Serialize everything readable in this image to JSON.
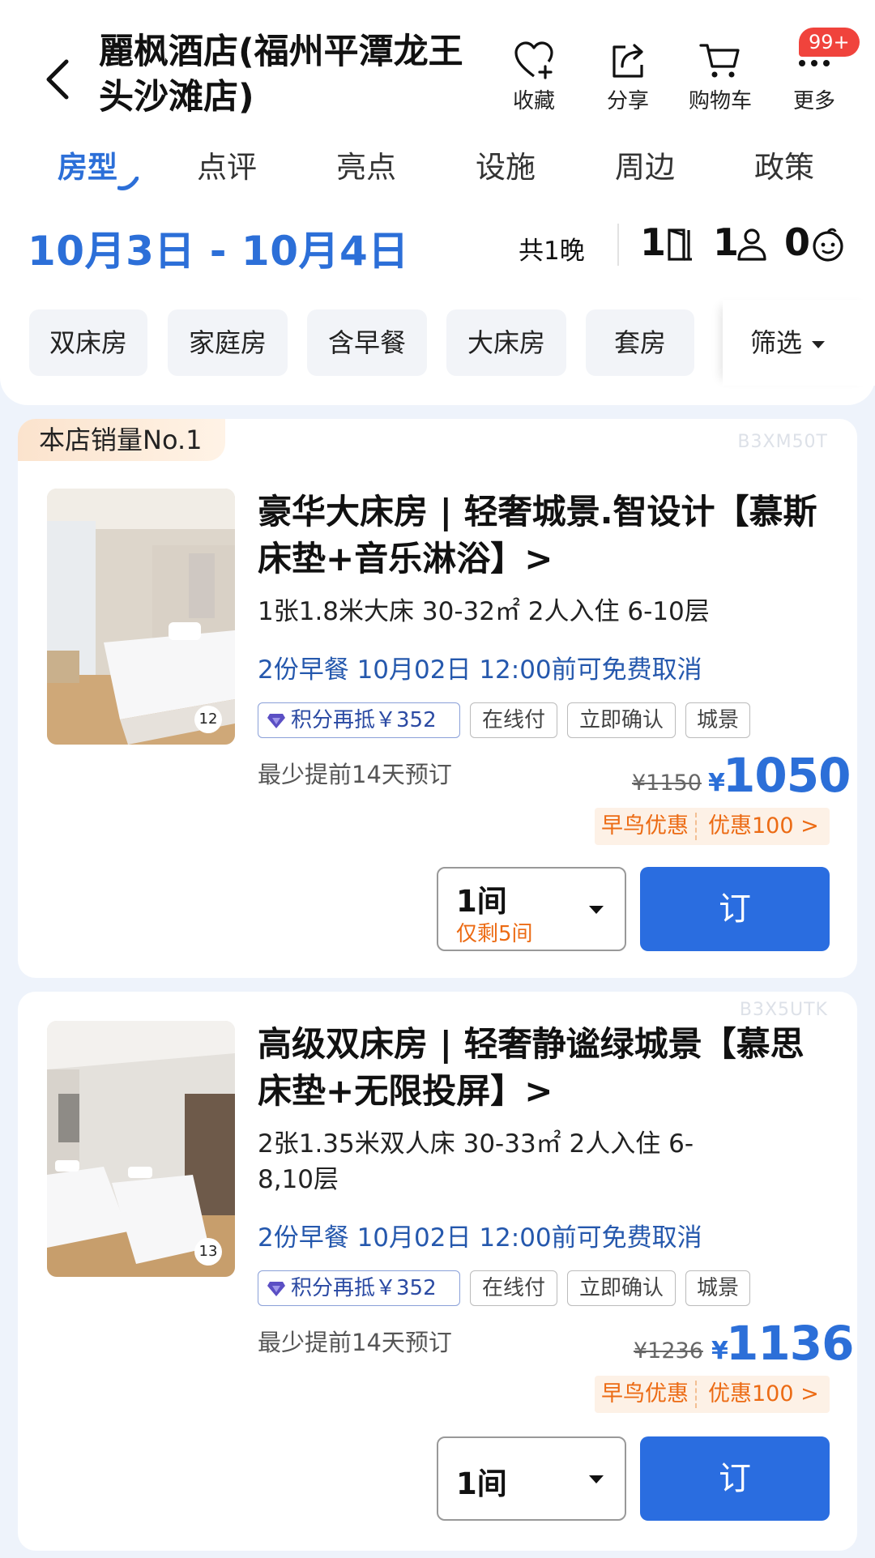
{
  "header": {
    "hotel_name": "麗枫酒店(福州平潭龙王头沙滩店)",
    "actions": [
      {
        "label": "收藏",
        "icon": "heart-plus-icon"
      },
      {
        "label": "分享",
        "icon": "share-icon"
      },
      {
        "label": "购物车",
        "icon": "cart-icon"
      },
      {
        "label": "更多",
        "icon": "more-icon"
      }
    ],
    "badge": "99+"
  },
  "tabs": [
    "房型",
    "点评",
    "亮点",
    "设施",
    "周边",
    "政策"
  ],
  "active_tab": "房型",
  "stay": {
    "dates": "10月3日 - 10月4日",
    "nights": "共1晚",
    "rooms": "1",
    "adults": "1",
    "children": "0"
  },
  "chips": [
    "双床房",
    "家庭房",
    "含早餐",
    "大床房",
    "套房"
  ],
  "filter_label": "筛选",
  "rooms": [
    {
      "rank_badge": "本店销量No.1",
      "code": "B3XM50T",
      "photo_count": "12",
      "title": "豪华大床房 | 轻奢城景.智设计【慕斯床垫+音乐淋浴】>",
      "info": "1张1.8米大床  30-32㎡  2人入住  6-10层",
      "breakfast_cancel": "2份早餐   10月02日 12:00前可免费取消",
      "tags": [
        "积分再抵￥352",
        "在线付",
        "立即确认",
        "城景"
      ],
      "advance": "最少提前14天预订",
      "old_price": "¥1150",
      "currency": "¥",
      "price": "1050",
      "promo_1": "早鸟优惠",
      "promo_2": "优惠100 >",
      "qty": "1间",
      "remaining": "仅剩5间",
      "book_label": "订"
    },
    {
      "code": "B3X5UTK",
      "photo_count": "13",
      "title": "高级双床房 | 轻奢静谧绿城景【慕思床垫+无限投屏】>",
      "info": "2张1.35米双人床  30-33㎡  2人入住 6-8,10层",
      "breakfast_cancel": "2份早餐   10月02日 12:00前可免费取消",
      "tags": [
        "积分再抵￥352",
        "在线付",
        "立即确认",
        "城景"
      ],
      "advance": "最少提前14天预订",
      "old_price": "¥1236",
      "currency": "¥",
      "price": "1136",
      "promo_1": "早鸟优惠",
      "promo_2": "优惠100 >",
      "qty": "1间",
      "book_label": "订"
    }
  ],
  "colors": {
    "accent": "#2c6fd8",
    "book_button": "#2a6de0",
    "promo_orange": "#ec6b14",
    "badge_red": "#f0433c",
    "page_bg": "#eef3fb"
  }
}
